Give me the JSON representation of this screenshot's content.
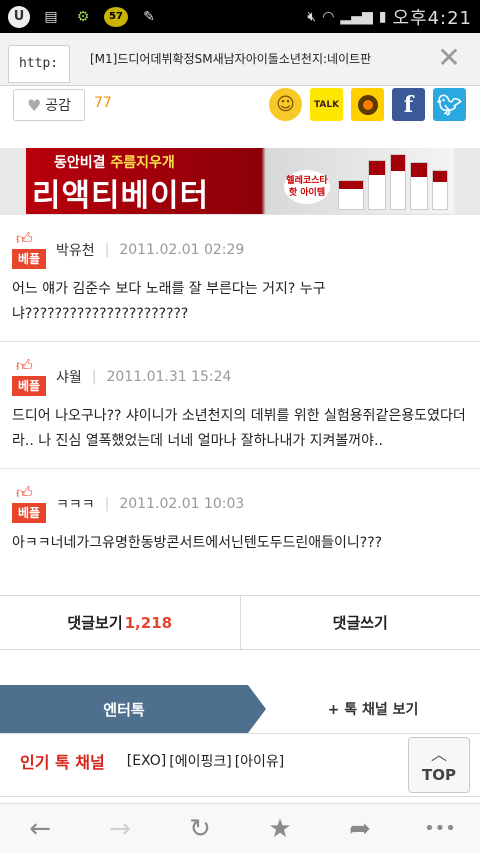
{
  "status_bar": {
    "time": "오후4:21",
    "notif_badge": "57",
    "icons": [
      "u-plus-icon",
      "sd-card-icon",
      "android-debug-icon",
      "badge-57-icon",
      "pen-icon",
      "mute-icon",
      "wifi-icon",
      "signal-icon",
      "battery-icon"
    ]
  },
  "browser": {
    "url_fragment": "http:",
    "page_title": "[M1]드디어데뷔확정SM새남자아이돌소년천지:네이트판",
    "close_label": "✕"
  },
  "actions": {
    "like_label": "공감",
    "like_count": "77",
    "share_icons": [
      "emoji-icon",
      "kakaotalk-icon",
      "kakaostory-icon",
      "facebook-icon",
      "twitter-icon"
    ],
    "talk_label": "TALK",
    "facebook_glyph": "f"
  },
  "banner": {
    "subtitle_white": "동안비결 ",
    "subtitle_yellow": "주름지우개",
    "main_text": "리액티베이터",
    "badge_text": "헬레코스타 핫 아이템"
  },
  "comments": [
    {
      "badge": "베플",
      "author": "박유천",
      "date": "2011.02.01 02:29",
      "body": "어느 얘가 김준수 보다 노래를 잘 부른다는 거지? 누구냐??????????????????????"
    },
    {
      "badge": "베플",
      "author": "샤월",
      "date": "2011.01.31 15:24",
      "body": "드디어 나오구나?? 샤이니가 소년천지의 데뷔를 위한 실험용쥐같은용도였다더라.. 나 진심 열폭했었는데 너네 얼마나 잘하나내가 지켜볼꺼야.."
    },
    {
      "badge": "베플",
      "author": "ㅋㅋㅋ",
      "date": "2011.02.01 10:03",
      "body": "아ㅋㅋ너네가그유명한동방콘서트에서닌텐도두드린애들이니???"
    }
  ],
  "comment_buttons": {
    "view_label": "댓글보기",
    "view_count": "1,218",
    "write_label": "댓글쓰기"
  },
  "talk_tabs": {
    "active": "엔터톡",
    "other": "+ 톡 채널 보기"
  },
  "popular": {
    "label": "인기 톡 채널",
    "items": [
      "[EXO]",
      "[에이핑크]",
      "[아이유]"
    ]
  },
  "top_button": {
    "chevron": "︿",
    "label": "TOP"
  },
  "toolbar": {
    "back": "←",
    "forward": "→",
    "refresh": "↻",
    "bookmark": "★",
    "share": "➦",
    "more": "•••"
  }
}
